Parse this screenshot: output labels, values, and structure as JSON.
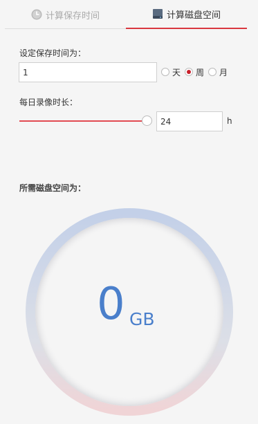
{
  "tabs": [
    {
      "label": "计算保存时间",
      "icon": "clock-icon",
      "active": false
    },
    {
      "label": "计算磁盘空间",
      "icon": "hard-disk-icon",
      "active": true
    }
  ],
  "retention": {
    "label": "设定保存时间为：",
    "value": "1",
    "options": [
      {
        "label": "天",
        "selected": false
      },
      {
        "label": "周",
        "selected": true
      },
      {
        "label": "月",
        "selected": false
      }
    ]
  },
  "recording": {
    "label": "每日录像时长：",
    "value": "24",
    "unit": "h",
    "slider_fraction": 1.0
  },
  "result": {
    "label": "所需磁盘空间为：",
    "value": "0",
    "unit": "GB"
  },
  "colors": {
    "accent": "#d9373f",
    "value": "#4a7fcb",
    "ring_top": "#c3d0e8",
    "ring_bottom": "#f0d4d6"
  }
}
